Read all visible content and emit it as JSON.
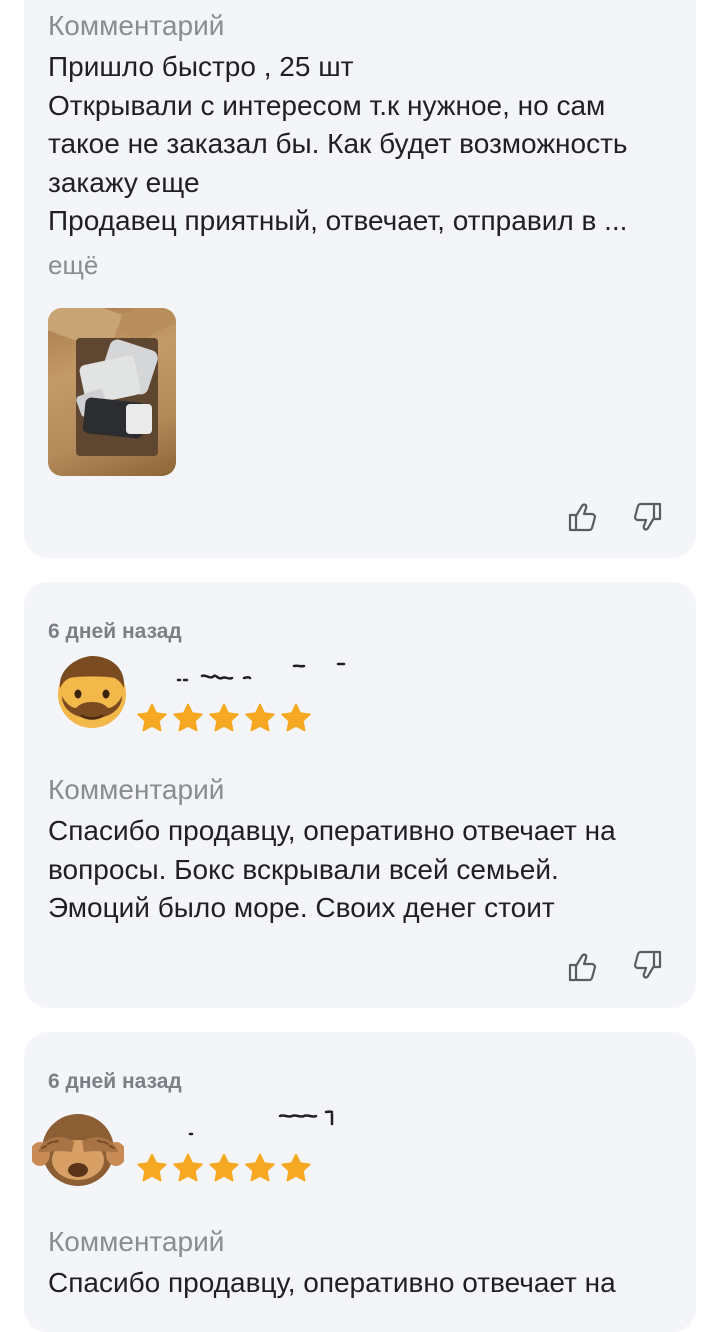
{
  "reviews": [
    {
      "comment_label": "Комментарий",
      "text_lines": [
        "Пришло быстро , 25 шт",
        "Открывали с интересом т.к нужное, но сам",
        "такое не заказал бы. Как будет возможность",
        "закажу еще",
        "Продавец приятный,  отвечает, отправил в ..."
      ],
      "more_label": "ещё",
      "photo_icon": "package-photo",
      "like_icon": "thumbs-up-icon",
      "dislike_icon": "thumbs-down-icon"
    },
    {
      "date": "6 дней назад",
      "avatar_icon": "bearded-man-emoji",
      "rating": 5,
      "comment_label": "Комментарий",
      "text_lines": [
        "Спасибо продавцу, оперативно отвечает на",
        "вопросы. Бокс вскрывали всей семьей.",
        "Эмоций было море. Своих денег стоит"
      ],
      "like_icon": "thumbs-up-icon",
      "dislike_icon": "thumbs-down-icon"
    },
    {
      "date": "6 дней назад",
      "avatar_icon": "see-no-evil-monkey-emoji",
      "rating": 5,
      "comment_label": "Комментарий",
      "text_lines": [
        "Спасибо продавцу, оперативно отвечает на"
      ]
    }
  ],
  "colors": {
    "card_bg": "#f4f5f8",
    "star": "#f7a823",
    "muted_text": "#8a8c93"
  }
}
